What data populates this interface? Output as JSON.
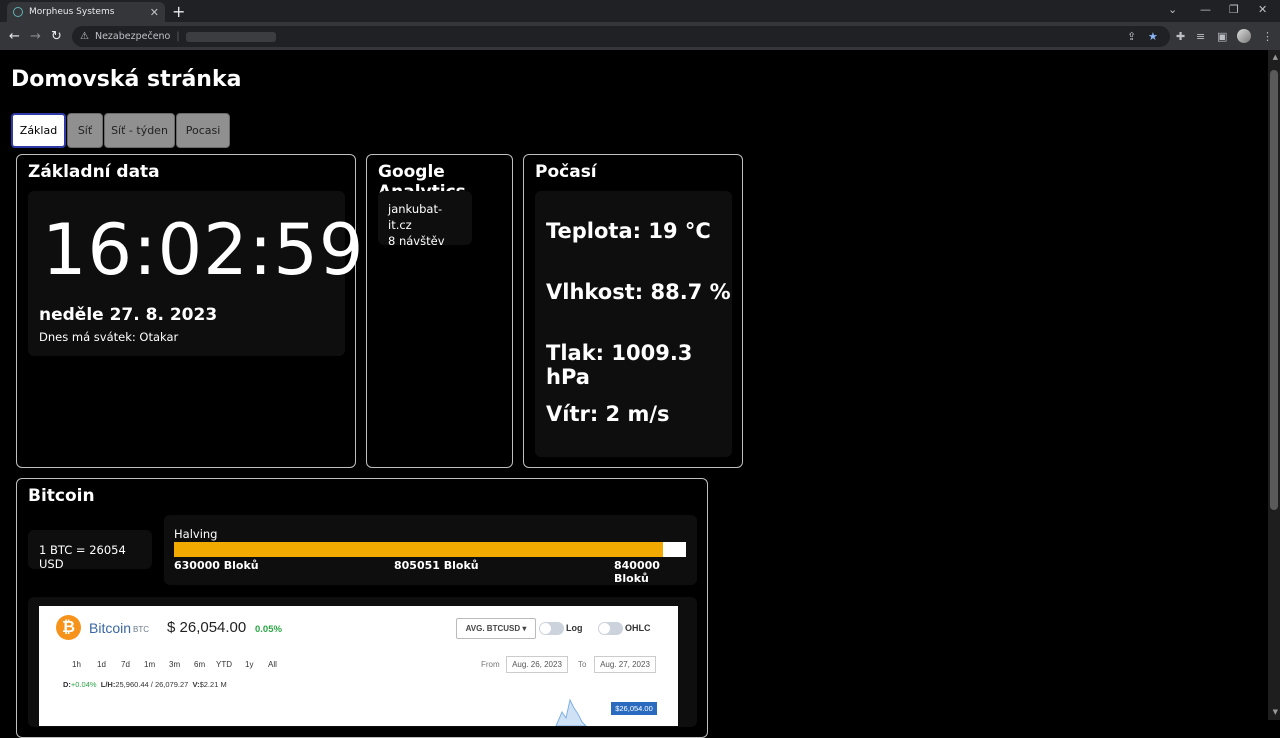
{
  "browser": {
    "tab_title": "Morpheus Systems",
    "tab_close": "✕",
    "new_tab": "+",
    "security_label": "Nezabezpečeno",
    "win_min": "—",
    "win_max": "❐",
    "win_close": "✕"
  },
  "page": {
    "title": "Domovská stránka",
    "tabs": [
      {
        "label": "Základ"
      },
      {
        "label": "Síť"
      },
      {
        "label": "Síť - týden"
      },
      {
        "label": "Pocasi"
      }
    ]
  },
  "basic": {
    "title": "Základní data",
    "time": "16:02:59",
    "date": "neděle 27. 8. 2023",
    "nameday": "Dnes má svátek: Otakar"
  },
  "analytics": {
    "title": "Google Analytics",
    "site": "jankubat-it.cz",
    "visits": "8 návštěv"
  },
  "weather": {
    "title": "Počasí",
    "temperature": "Teplota: 19 °C",
    "humidity": "Vlhkost: 88.7 %",
    "pressure": "Tlak: 1009.3 hPa",
    "wind": "Vítr: 2 m/s"
  },
  "bitcoin": {
    "title": "Bitcoin",
    "price": "1 BTC = 26054 USD",
    "halving_label": "Halving",
    "halving_progress": 0.956,
    "blocks_start": "630000 Bloků",
    "blocks_current": "805051 Bloků",
    "blocks_end": "840000 Bloků",
    "accent_color": "#f2a900"
  },
  "widget": {
    "logo": "₿",
    "name": "Bitcoin",
    "symbol": "BTC",
    "price": "$ 26,054.00",
    "change": "0.05%",
    "pair": "AVG. BTCUSD ▾",
    "log_label": "Log",
    "ohlc_label": "OHLC",
    "ranges": [
      "1h",
      "1d",
      "7d",
      "1m",
      "3m",
      "6m",
      "YTD",
      "1y",
      "All"
    ],
    "from_label": "From",
    "from_date": "Aug. 26, 2023",
    "to_label": "To",
    "to_date": "Aug. 27, 2023",
    "stat_d_label": "D:",
    "stat_d": "+0.04%",
    "stat_lh_label": "L/H:",
    "stat_lh": "25,960.44 / 26,079.27",
    "stat_v_label": "V:",
    "stat_v": "$2.21 M",
    "price_tag": "$26,054.00"
  }
}
